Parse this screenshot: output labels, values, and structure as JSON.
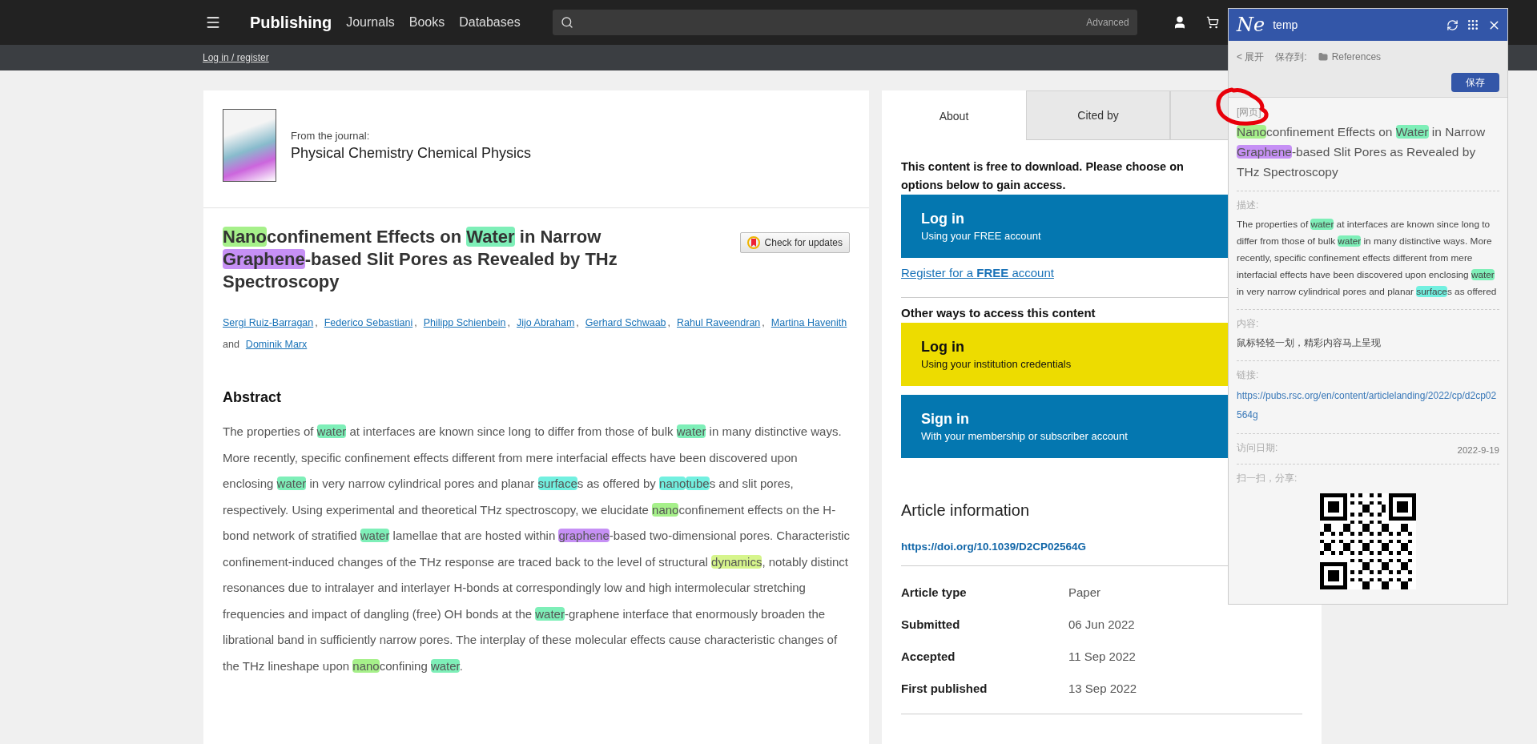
{
  "header": {
    "brand": "Publishing",
    "nav": [
      "Journals",
      "Books",
      "Databases"
    ],
    "search": {
      "advanced": "Advanced"
    }
  },
  "subbar": {
    "login_link": "Log in / register"
  },
  "journal": {
    "from_label": "From the journal:",
    "name": "Physical Chemistry Chemical Physics"
  },
  "article": {
    "title": [
      {
        "text": "Nano",
        "color": "#a6f08a"
      },
      {
        "text": "confinement Effects on "
      },
      {
        "text": "Water",
        "color": "#7eefb8"
      },
      {
        "text": " in Narrow "
      },
      {
        "text": "Graphene",
        "color": "#c690f5"
      },
      {
        "text": "-based Slit Pores as Revealed by THz Spectroscopy"
      }
    ],
    "check_updates": "Check for updates",
    "authors": [
      {
        "name": "Sergi Ruiz-Barragan",
        "separator": ","
      },
      {
        "name": "Federico Sebastiani",
        "separator": ","
      },
      {
        "name": "Philipp Schienbein",
        "separator": ","
      },
      {
        "name": "Jijo Abraham",
        "separator": ","
      },
      {
        "name": "Gerhard Schwaab",
        "separator": ","
      },
      {
        "name": "Rahul Raveendran",
        "separator": ","
      },
      {
        "name": "Martina Havenith",
        "separator": "and"
      },
      {
        "name": "Dominik Marx"
      }
    ],
    "abstract_heading": "Abstract",
    "abstract": [
      {
        "text": "The properties of "
      },
      {
        "text": "water",
        "color": "#7eefb8"
      },
      {
        "text": " at interfaces are known since long to differ from those of bulk "
      },
      {
        "text": "water",
        "color": "#7eefb8"
      },
      {
        "text": " in many distinctive ways. More recently, specific confinement effects different from mere interfacial effects have been discovered upon enclosing "
      },
      {
        "text": "water",
        "color": "#7eefb8"
      },
      {
        "text": " in very narrow cylindrical pores and planar "
      },
      {
        "text": "surface",
        "color": "#72f0e0"
      },
      {
        "text": "s as offered by "
      },
      {
        "text": "nano",
        "color": "#72f0e0"
      },
      {
        "text": "tube",
        "color": "#72f0e0"
      },
      {
        "text": "s and slit pores, respectively. Using experimental and theoretical THz spectroscopy, we elucidate "
      },
      {
        "text": "nano",
        "color": "#a6f08a"
      },
      {
        "text": "confinement effects on the H-bond network of stratified "
      },
      {
        "text": "water",
        "color": "#7eefb8"
      },
      {
        "text": " lamellae that are hosted within "
      },
      {
        "text": "graphene",
        "color": "#c690f5"
      },
      {
        "text": "-based two-dimensional pores. Characteristic confinement-induced changes of the THz response are traced back to the level of structural "
      },
      {
        "text": "dynamics",
        "color": "#d6f58c"
      },
      {
        "text": ", notably distinct resonances due to intralayer and interlayer H-bonds at correspondingly low and high intermolecular stretching frequencies and impact of dangling (free) OH bonds at the "
      },
      {
        "text": "water",
        "color": "#7eefb8"
      },
      {
        "text": "-graphene interface that enormously broaden the librational band in sufficiently narrow pores. The interplay of these molecular effects cause characteristic changes of the THz lineshape upon "
      },
      {
        "text": "nano",
        "color": "#a6f08a"
      },
      {
        "text": "confining "
      },
      {
        "text": "water",
        "color": "#7eefb8"
      },
      {
        "text": "."
      }
    ]
  },
  "tabs": [
    {
      "label": "About",
      "selected": true
    },
    {
      "label": "Cited by",
      "selected": false
    },
    {
      "selected": false
    }
  ],
  "access": {
    "intro": "This content is free to download. Please choose on",
    "line2": "options below to gain access.",
    "options": [
      {
        "kind": "primary",
        "title": "Log in",
        "subtitle": "Using your FREE account"
      }
    ],
    "register": "Register for a **FREE** account",
    "other_heading": "Other ways to access this content",
    "other_options": [
      {
        "kind": "institution",
        "title": "Log in",
        "subtitle": "Using your institution credentials"
      },
      {
        "kind": "primary",
        "title": "Sign in",
        "subtitle": "With your membership or subscriber account"
      }
    ]
  },
  "article_info": {
    "heading": "Article information",
    "doi": "https://doi.org/10.1039/D2CP02564G",
    "rows": [
      {
        "label": "Article type",
        "value": "Paper"
      },
      {
        "label": "Submitted",
        "value": "06 Jun 2022"
      },
      {
        "label": "Accepted",
        "value": "11 Sep 2022"
      },
      {
        "label": "First published",
        "value": "13 Sep 2022"
      }
    ]
  },
  "popup": {
    "logo": "Ne",
    "title": "temp",
    "back": "< 展开",
    "save_to": "保存到:",
    "folder": "References",
    "save": "保存",
    "type_tag": "[网页]",
    "title_text": [
      {
        "text": "Nano",
        "color": "#a6f08a"
      },
      {
        "text": "confinement Effects on "
      },
      {
        "text": "Water",
        "color": "#7eefb8"
      },
      {
        "text": " in Narrow "
      },
      {
        "text": "Graphene",
        "color": "#c690f5"
      },
      {
        "text": "-based Slit Pores as Revealed by THz Spectroscopy"
      }
    ],
    "desc_label": "描述:",
    "description": [
      {
        "text": "The properties of "
      },
      {
        "text": "water",
        "color": "#7eefb8"
      },
      {
        "text": " at interfaces are known since long to differ from those of bulk "
      },
      {
        "text": "water",
        "color": "#7eefb8"
      },
      {
        "text": " in many distinctive ways. More recently, specific confinement effects different from mere interfacial effects have been discovered upon enclosing "
      },
      {
        "text": "water",
        "color": "#7eefb8"
      },
      {
        "text": " in very narrow cylindrical pores and planar "
      },
      {
        "text": "surface",
        "color": "#72f0e0"
      },
      {
        "text": "s as offered"
      }
    ],
    "content_label": "内容:",
    "content": "鼠标轻轻一划，精彩内容马上呈现",
    "link_label": "链接:",
    "link": "https://pubs.rsc.org/en/content/articlelanding/2022/cp/d2cp02564g",
    "date_label": "访问日期:",
    "date": "2022-9-19",
    "share_label": "扫一扫，分享:"
  }
}
